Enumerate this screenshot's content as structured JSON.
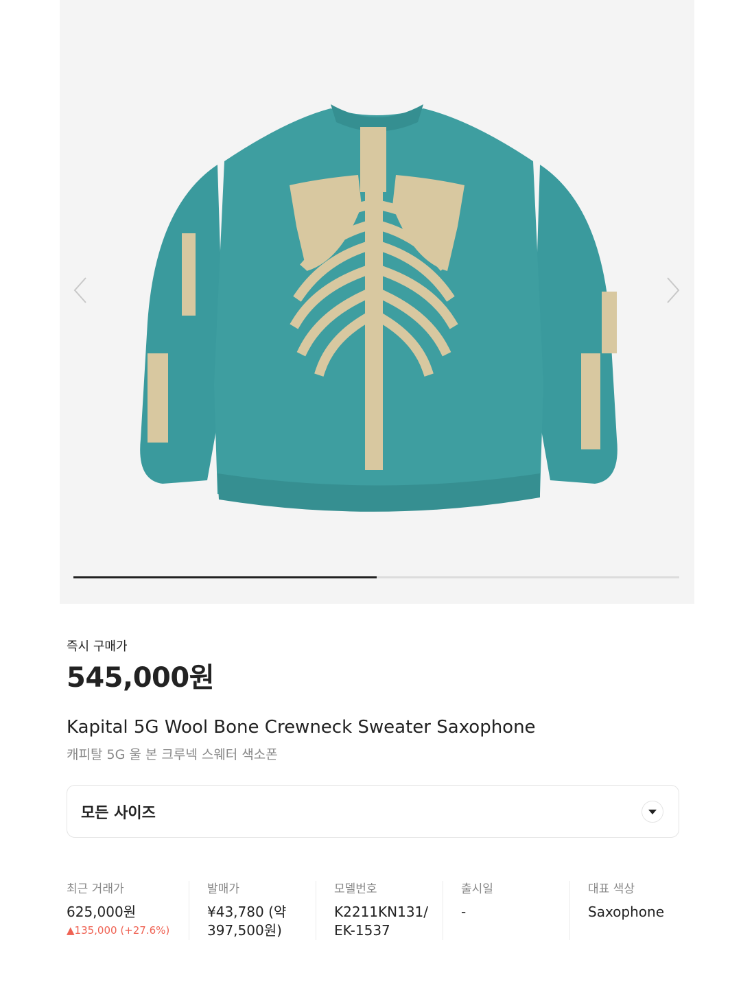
{
  "gallery": {
    "image_alt": "Kapital 5G Wool Bone Crewneck Sweater Saxophone",
    "prev_icon": "chevron-left-icon",
    "next_icon": "chevron-right-icon",
    "progress_fraction": 0.5,
    "colors": {
      "background": "#f4f4f4",
      "sweater": "#3e9ea0",
      "bone": "#d8c8a0"
    }
  },
  "buy_now": {
    "label": "즉시 구매가",
    "price": "545,000원"
  },
  "product": {
    "name_en": "Kapital 5G Wool Bone Crewneck Sweater Saxophone",
    "name_ko": "캐피탈 5G 울 본 크루넥 스웨터 색소폰"
  },
  "size_selector": {
    "label": "모든 사이즈",
    "icon": "caret-down-icon"
  },
  "details": [
    {
      "key": "최근 거래가",
      "value": "625,000원",
      "change": "▲135,000 (+27.6%)"
    },
    {
      "key": "발매가",
      "value": "¥43,780 (약 397,500원)"
    },
    {
      "key": "모델번호",
      "value": "K2211KN131/ EK-1537"
    },
    {
      "key": "출시일",
      "value": "-"
    },
    {
      "key": "대표 색상",
      "value": "Saxophone"
    }
  ],
  "colors": {
    "accent_up": "#ef6253",
    "text_main": "#222222",
    "text_muted": "#888888"
  }
}
